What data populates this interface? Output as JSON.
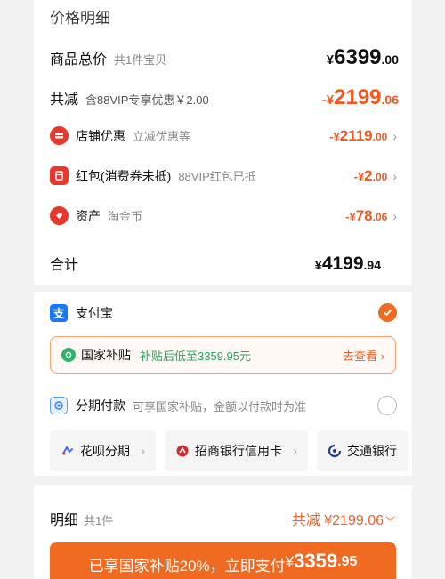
{
  "price_detail": {
    "title": "价格明细",
    "goods_total": {
      "label": "商品总价",
      "sub": "共1件宝贝",
      "yen": "¥",
      "int": "6399",
      "dec": ".00"
    },
    "total_reduce": {
      "label": "共减",
      "sub": "含88VIP专享优惠￥2.00",
      "yen": "-¥",
      "int": "2199",
      "dec": ".06"
    },
    "discounts": [
      {
        "label": "店铺优惠",
        "sub": "立减优惠等",
        "yen": "-¥",
        "int": "2119",
        "dec": ".00",
        "icon": "store-coupon-icon",
        "color": "#e8372c"
      },
      {
        "label": "红包(消费券未抵)",
        "sub": "88VIP红包已抵",
        "yen": "-¥",
        "int": "2",
        "dec": ".00",
        "icon": "red-packet-icon",
        "color": "#e8372c"
      },
      {
        "label": "资产",
        "sub": "淘金币",
        "yen": "-¥",
        "int": "78",
        "dec": ".06",
        "icon": "tag-icon",
        "color": "#e8372c"
      }
    ],
    "total": {
      "label": "合计",
      "yen": "¥",
      "int": "4199",
      "dec": ".94"
    }
  },
  "payment": {
    "alipay": {
      "label": "支付宝",
      "icon": "alipay-icon",
      "selected": true
    },
    "subsidy": {
      "label": "国家补贴",
      "note": "补贴后低至3359.95元",
      "link": "去查看 ›"
    },
    "installment": {
      "label": "分期付款",
      "sub": "可享国家补贴，金额以付款时为准",
      "icon": "installment-icon",
      "selected": false
    },
    "options": [
      {
        "label": "花呗分期",
        "icon": "huabei-icon"
      },
      {
        "label": "招商银行信用卡",
        "icon": "cmb-bank-icon"
      },
      {
        "label": "交通银行",
        "icon": "bocom-bank-icon"
      }
    ]
  },
  "bottom": {
    "detail_label": "明细",
    "detail_sub": "共1件",
    "reduce_text": "共减 ¥2199.06",
    "button": {
      "text": "已享国家补贴20%，立即支付",
      "yen": "¥",
      "int": "3359",
      "dec": ".95"
    }
  },
  "colors": {
    "accent": "#f06a22",
    "discount": "#f05a22",
    "subsidy_green": "#26a65b",
    "alipay_blue": "#1677ff"
  }
}
